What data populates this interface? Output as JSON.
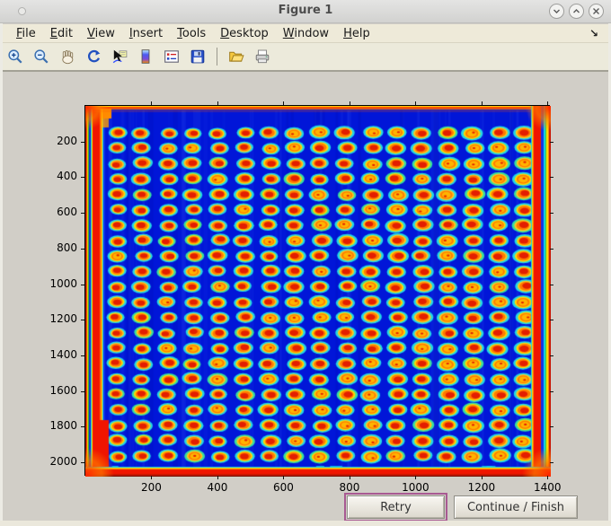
{
  "window": {
    "title": "Figure 1",
    "controls": {
      "minimize": "chevron-down",
      "maximize": "chevron-up",
      "close": "x"
    }
  },
  "menubar": {
    "items": [
      "File",
      "Edit",
      "View",
      "Insert",
      "Tools",
      "Desktop",
      "Window",
      "Help"
    ],
    "dock_glyph": "↘"
  },
  "toolbar": {
    "icons": [
      "zoom-in",
      "zoom-out",
      "pan",
      "rotate-3d",
      "data-cursor",
      "colorbar",
      "legend",
      "save",
      "open",
      "print"
    ]
  },
  "plot": {
    "type": "heatmap",
    "description": "Microarray plate scan rendered with jet colormap: deep blue field, 22x17 grid of spots with red cores, yellow rings and cyan halos, saturated red bands along all four edges",
    "grid_rows": 22,
    "grid_cols": 17,
    "x_ticks": [
      200,
      400,
      600,
      800,
      1000,
      1200,
      1400
    ],
    "y_ticks": [
      200,
      400,
      600,
      800,
      1000,
      1200,
      1400,
      1600,
      1800,
      2000
    ],
    "x_range": [
      0,
      1410
    ],
    "y_range": [
      0,
      2080
    ],
    "colors": {
      "background": "#0116d8",
      "spot_core": "#e31e00",
      "spot_mid": "#ff7a00",
      "spot_ring": "#ffd900",
      "spot_halo": "#23d8e6",
      "edge_band": "#f01500"
    }
  },
  "buttons": {
    "retry": "Retry",
    "continue_finish": "Continue / Finish"
  }
}
